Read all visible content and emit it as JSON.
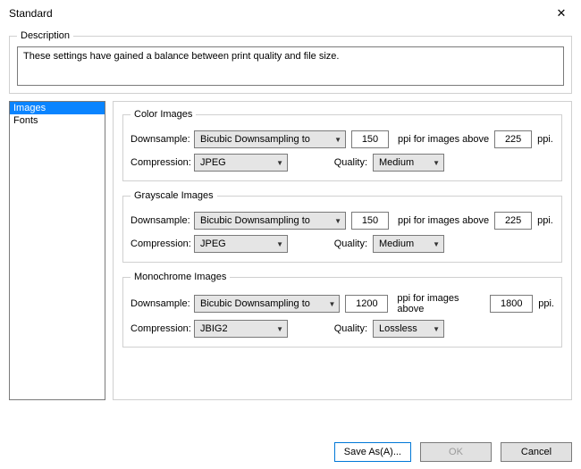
{
  "window": {
    "title": "Standard",
    "close_glyph": "✕"
  },
  "description": {
    "legend": "Description",
    "text": "These settings have gained a balance between print quality and file size."
  },
  "sidebar": {
    "items": [
      {
        "label": "Images",
        "selected": true
      },
      {
        "label": "Fonts",
        "selected": false
      }
    ]
  },
  "labels": {
    "downsample": "Downsample:",
    "compression": "Compression:",
    "quality": "Quality:",
    "ppi_mid": "ppi for images above",
    "ppi_end": "ppi."
  },
  "groups": {
    "color": {
      "legend": "Color Images",
      "downsample_method": "Bicubic Downsampling to",
      "downsample_ppi": "150",
      "above_ppi": "225",
      "compression": "JPEG",
      "quality": "Medium"
    },
    "gray": {
      "legend": "Grayscale Images",
      "downsample_method": "Bicubic Downsampling to",
      "downsample_ppi": "150",
      "above_ppi": "225",
      "compression": "JPEG",
      "quality": "Medium"
    },
    "mono": {
      "legend": "Monochrome Images",
      "downsample_method": "Bicubic Downsampling to",
      "downsample_ppi": "1200",
      "above_ppi": "1800",
      "compression": "JBIG2",
      "quality": "Lossless"
    }
  },
  "footer": {
    "save_as": "Save As(A)...",
    "ok": "OK",
    "cancel": "Cancel"
  },
  "combo_arrow": "▼"
}
